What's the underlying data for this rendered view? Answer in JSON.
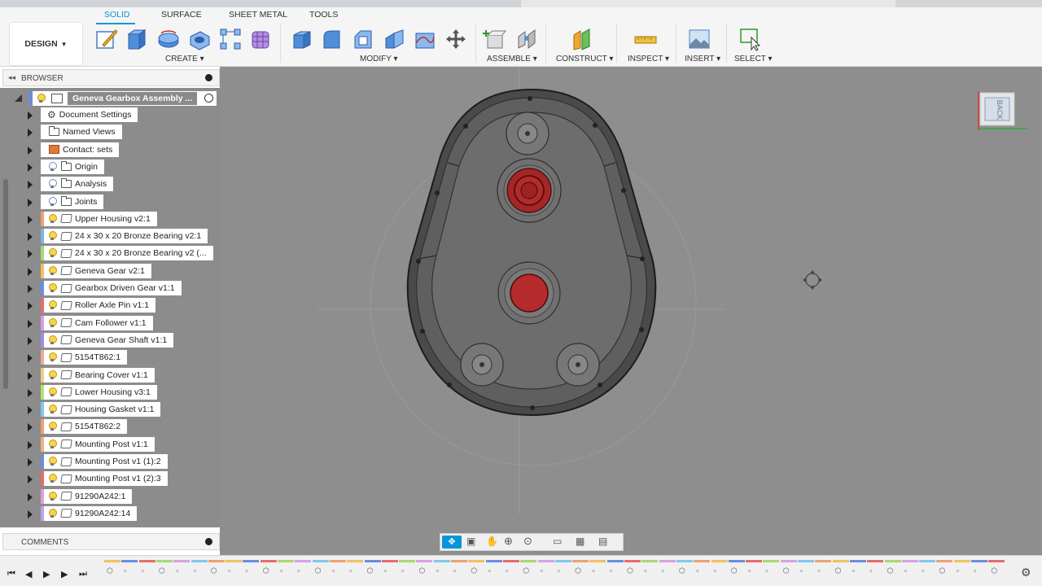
{
  "tabs": [
    "SOLID",
    "SURFACE",
    "SHEET METAL",
    "TOOLS"
  ],
  "workspace": {
    "label": "DESIGN"
  },
  "groups": {
    "create": "CREATE",
    "modify": "MODIFY",
    "assemble": "ASSEMBLE",
    "construct": "CONSTRUCT",
    "inspect": "INSPECT",
    "insert": "INSERT",
    "select": "SELECT"
  },
  "browser": {
    "title": "BROWSER",
    "root": "Geneva Gearbox Assembly ...",
    "items": [
      {
        "label": "Document Settings",
        "icon": "gear-icon",
        "bulb": "none"
      },
      {
        "label": "Named Views",
        "icon": "folder-icon",
        "bulb": "none"
      },
      {
        "label": "Contact: sets",
        "icon": "contact-sets-icon",
        "bulb": "none"
      },
      {
        "label": "Origin",
        "icon": "folder-icon",
        "bulb": "off"
      },
      {
        "label": "Analysis",
        "icon": "folder-icon",
        "bulb": "off"
      },
      {
        "label": "Joints",
        "icon": "folder-icon",
        "bulb": "off"
      },
      {
        "label": "Upper Housing v2:1",
        "icon": "component-icon",
        "bulb": "on",
        "color": "#f0a070"
      },
      {
        "label": "24 x 30 x 20 Bronze Bearing v2:1",
        "icon": "component-icon",
        "bulb": "on",
        "color": "#7fb0e8"
      },
      {
        "label": "24 x 30 x 20 Bronze Bearing v2 (...",
        "icon": "component-icon",
        "bulb": "on",
        "color": "#a8d870"
      },
      {
        "label": "Geneva Gear v2:1",
        "icon": "component-icon",
        "bulb": "on",
        "color": "#f0c060"
      },
      {
        "label": "Gearbox Driven Gear v1:1",
        "icon": "component-icon",
        "bulb": "on",
        "color": "#6a8de0"
      },
      {
        "label": "Roller Axle Pin v1:1",
        "icon": "component-icon",
        "bulb": "on",
        "color": "#e86b6b"
      },
      {
        "label": "Cam Follower v1:1",
        "icon": "component-icon",
        "bulb": "on",
        "color": "#d8a0e0"
      },
      {
        "label": "Geneva Gear Shaft v1:1",
        "icon": "component-icon",
        "bulb": "on",
        "color": "#9b8de8"
      },
      {
        "label": "5154T862:1",
        "icon": "component-icon",
        "bulb": "on",
        "color": "#f0a898"
      },
      {
        "label": "Bearing Cover v1:1",
        "icon": "component-icon",
        "bulb": "on",
        "color": "#f0c890"
      },
      {
        "label": "Lower Housing v3:1",
        "icon": "component-icon",
        "bulb": "on",
        "color": "#b0e070"
      },
      {
        "label": "Housing Gasket v1:1",
        "icon": "component-icon",
        "bulb": "on",
        "color": "#80c8f0"
      },
      {
        "label": "5154T862:2",
        "icon": "component-icon",
        "bulb": "on",
        "color": "#f0a070"
      },
      {
        "label": "Mounting Post v1:1",
        "icon": "component-icon",
        "bulb": "on",
        "color": "#f0b080"
      },
      {
        "label": "Mounting Post v1 (1):2",
        "icon": "component-icon",
        "bulb": "on",
        "color": "#6a8de0"
      },
      {
        "label": "Mounting Post v1 (2):3",
        "icon": "component-icon",
        "bulb": "on",
        "color": "#e86b6b"
      },
      {
        "label": "91290A242:1",
        "icon": "component-icon",
        "bulb": "on",
        "color": "#e0a0d8"
      },
      {
        "label": "91290A242:14",
        "icon": "component-icon",
        "bulb": "on",
        "color": "#c0a0f0"
      }
    ]
  },
  "comments": {
    "title": "COMMENTS"
  },
  "viewcube": {
    "face": "BACK"
  },
  "colors": {
    "accent": "#0696d7",
    "viewport_bg": "#8e8e8e",
    "part_red": "#b52b2b"
  }
}
